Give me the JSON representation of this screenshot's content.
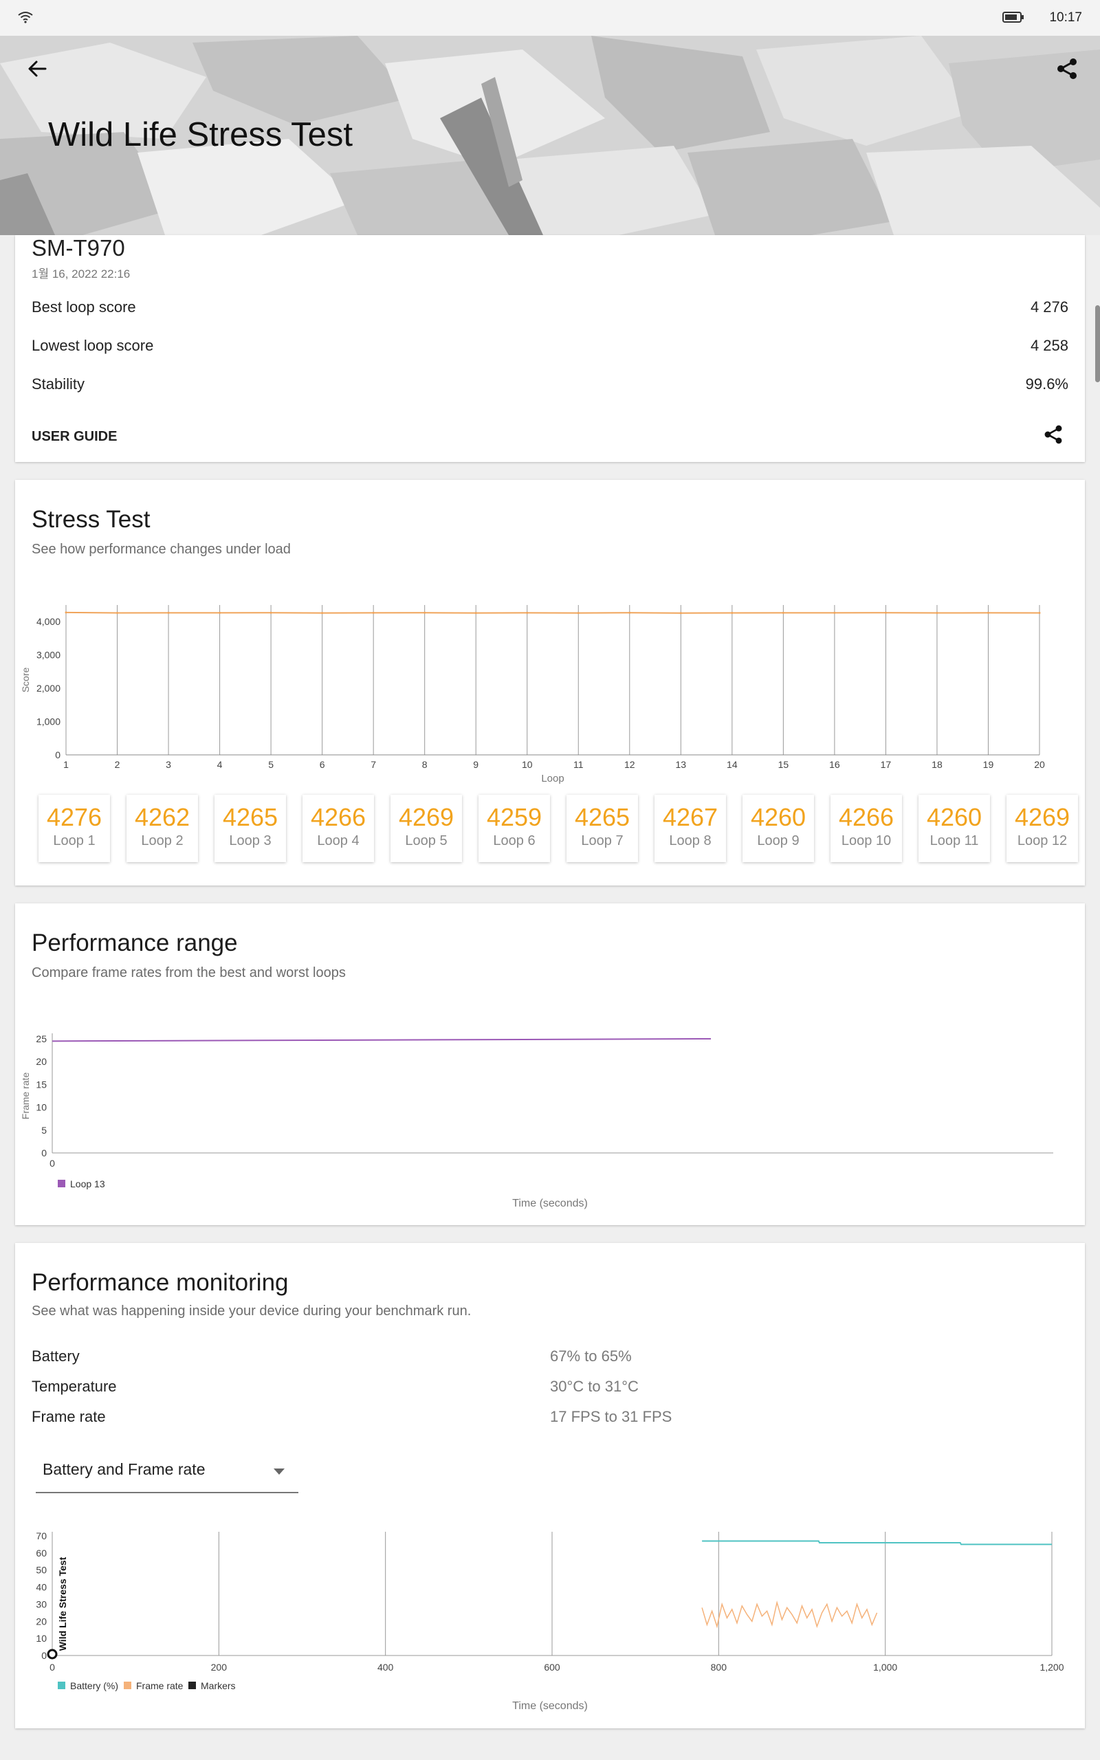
{
  "status": {
    "time": "10:17",
    "wifi_icon": "wifi-icon",
    "battery_icon": "battery-icon"
  },
  "header": {
    "title": "Wild Life Stress Test",
    "back_icon": "arrow-left-icon",
    "share_icon": "share-icon"
  },
  "summary": {
    "device": "SM-T970",
    "date": "1월 16, 2022 22:16",
    "rows": [
      {
        "label": "Best loop score",
        "value": "4 276"
      },
      {
        "label": "Lowest loop score",
        "value": "4 258"
      },
      {
        "label": "Stability",
        "value": "99.6%"
      }
    ],
    "user_guide": "USER GUIDE"
  },
  "stress": {
    "title": "Stress Test",
    "subtitle": "See how performance changes under load",
    "tiles": [
      {
        "score": "4276",
        "label": "Loop 1"
      },
      {
        "score": "4262",
        "label": "Loop 2"
      },
      {
        "score": "4265",
        "label": "Loop 3"
      },
      {
        "score": "4266",
        "label": "Loop 4"
      },
      {
        "score": "4269",
        "label": "Loop 5"
      },
      {
        "score": "4259",
        "label": "Loop 6"
      },
      {
        "score": "4265",
        "label": "Loop 7"
      },
      {
        "score": "4267",
        "label": "Loop 8"
      },
      {
        "score": "4260",
        "label": "Loop 9"
      },
      {
        "score": "4266",
        "label": "Loop 10"
      },
      {
        "score": "4260",
        "label": "Loop 11"
      },
      {
        "score": "4269",
        "label": "Loop 12"
      }
    ]
  },
  "range": {
    "title": "Performance range",
    "subtitle": "Compare frame rates from the best and worst loops"
  },
  "monitoring": {
    "title": "Performance monitoring",
    "subtitle": "See what was happening inside your device during your benchmark run.",
    "rows": [
      {
        "label": "Battery",
        "value": "67% to 65%"
      },
      {
        "label": "Temperature",
        "value": "30°C to 31°C"
      },
      {
        "label": "Frame rate",
        "value": "17 FPS to 31 FPS"
      }
    ],
    "selected": "Battery and Frame rate"
  },
  "chart_data": [
    {
      "type": "line",
      "xlabel": "Loop",
      "ylabel": "Score",
      "x": [
        1,
        2,
        3,
        4,
        5,
        6,
        7,
        8,
        9,
        10,
        11,
        12,
        13,
        14,
        15,
        16,
        17,
        18,
        19,
        20
      ],
      "x_ticks": [
        "1",
        "2",
        "3",
        "4",
        "5",
        "6",
        "7",
        "8",
        "9",
        "10",
        "11",
        "12",
        "13",
        "14",
        "15",
        "16",
        "17",
        "18",
        "19",
        "20"
      ],
      "ylim": [
        0,
        4500
      ],
      "y_ticks": [
        "0",
        "1,000",
        "2,000",
        "3,000",
        "4,000"
      ],
      "y_tick_values": [
        0,
        1000,
        2000,
        3000,
        4000
      ],
      "series": [
        {
          "values": [
            4276,
            4262,
            4265,
            4266,
            4269,
            4259,
            4265,
            4267,
            4260,
            4266,
            4260,
            4269,
            4258,
            4262,
            4265,
            4266,
            4268,
            4262,
            4265,
            4263
          ]
        }
      ],
      "colors": {
        "line": "#f0a45a",
        "grid": "#999999"
      },
      "grid": true
    },
    {
      "type": "line",
      "xlabel": "Time (seconds)",
      "ylabel": "Frame rate",
      "ylim": [
        0,
        25
      ],
      "y_ticks": [
        "0",
        "5",
        "10",
        "15",
        "20",
        "25"
      ],
      "y_tick_values": [
        0,
        5,
        10,
        15,
        20,
        25
      ],
      "x_ticks": [
        "0"
      ],
      "series": [
        {
          "name": "Loop 13",
          "x": [
            0,
            1
          ],
          "values": [
            24.5,
            25
          ]
        }
      ],
      "legend": "bottom-left",
      "colors": {
        "line": "#9b59b6"
      }
    },
    {
      "type": "line",
      "xlabel": "Time (seconds)",
      "ylabel": "Wild Life Stress Test",
      "xlim": [
        0,
        1200
      ],
      "ylim": [
        0,
        70
      ],
      "x_ticks": [
        "0",
        "200",
        "400",
        "600",
        "800",
        "1,000",
        "1,200"
      ],
      "x_tick_values": [
        0,
        200,
        400,
        600,
        800,
        1000,
        1200
      ],
      "y_ticks": [
        "0",
        "10",
        "20",
        "30",
        "40",
        "50",
        "60",
        "70"
      ],
      "y_tick_values": [
        0,
        10,
        20,
        30,
        40,
        50,
        60,
        70
      ],
      "series": [
        {
          "name": "Battery (%)",
          "x": [
            780,
            920,
            921,
            1090,
            1091,
            1200
          ],
          "values": [
            67,
            67,
            66,
            66,
            65,
            65
          ]
        },
        {
          "name": "Frame rate",
          "x": [
            780,
            786,
            792,
            798,
            804,
            810,
            816,
            822,
            828,
            834,
            840,
            846,
            852,
            858,
            864,
            870,
            876,
            882,
            888,
            894,
            900,
            906,
            912,
            918,
            924,
            930,
            936,
            942,
            948,
            954,
            960,
            966,
            972,
            978,
            984,
            990
          ],
          "values": [
            28,
            18,
            26,
            17,
            30,
            22,
            27,
            19,
            29,
            24,
            20,
            30,
            23,
            26,
            18,
            31,
            21,
            28,
            24,
            19,
            29,
            22,
            27,
            17,
            25,
            30,
            20,
            28,
            23,
            26,
            19,
            30,
            22,
            27,
            18,
            25
          ]
        },
        {
          "name": "Markers",
          "values": []
        }
      ],
      "legend": "bottom-left",
      "colors": {
        "battery": "#4fc3c3",
        "frame": "#f5b27a",
        "markers": "#222222"
      },
      "grid": true
    }
  ]
}
